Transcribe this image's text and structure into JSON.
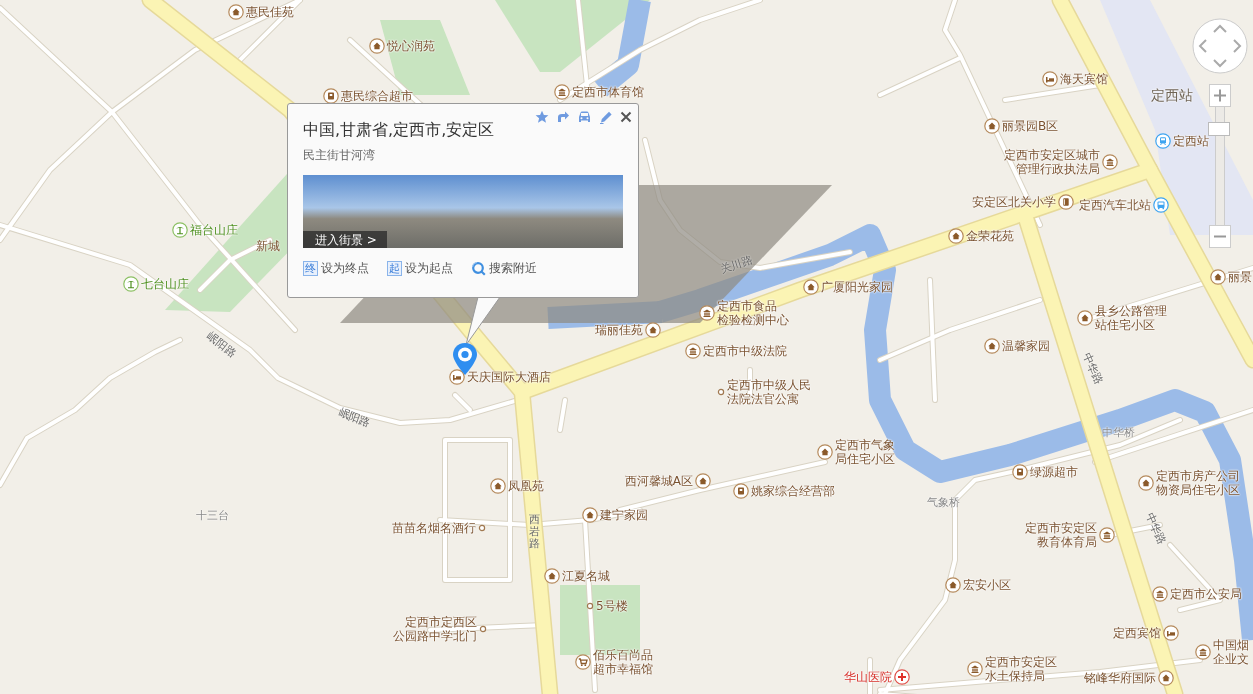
{
  "popup": {
    "title": "中国,甘肃省,定西市,安定区",
    "subtitle": "民主街甘河湾",
    "street_view_link": "进入街景 >",
    "actions": [
      {
        "kind": "badge",
        "badge": "终",
        "label": "设为终点"
      },
      {
        "kind": "badge",
        "badge": "起",
        "label": "设为起点"
      },
      {
        "kind": "search",
        "label": "搜索附近"
      }
    ]
  },
  "map": {
    "places": [
      {
        "kind": "house",
        "lines": [
          "惠民佳苑"
        ]
      },
      {
        "kind": "house",
        "lines": [
          "悦心润苑"
        ]
      },
      {
        "kind": "shop",
        "lines": [
          "惠民综合超市"
        ]
      },
      {
        "kind": "office",
        "lines": [
          "定西市体育馆"
        ]
      },
      {
        "kind": "hotel",
        "lines": [
          "海天宾馆"
        ]
      },
      {
        "kind": "house",
        "lines": [
          "丽景园B区"
        ]
      },
      {
        "kind": "metro",
        "lines": [
          "定西站"
        ]
      },
      {
        "kind": "office",
        "lines": [
          "定西市安定区城市",
          "管理行政执法局"
        ]
      },
      {
        "kind": "school",
        "lines": [
          "安定区北关小学"
        ]
      },
      {
        "kind": "bus",
        "lines": [
          "定西汽车北站"
        ]
      },
      {
        "kind": "house",
        "lines": [
          "金荣花苑"
        ]
      },
      {
        "kind": "house",
        "lines": [
          "丽景"
        ]
      },
      {
        "kind": "house",
        "lines": [
          "广厦阳光家园"
        ]
      },
      {
        "kind": "office",
        "lines": [
          "定西市食品",
          "检验检测中心"
        ]
      },
      {
        "kind": "house",
        "lines": [
          "瑞丽佳苑"
        ]
      },
      {
        "kind": "house",
        "lines": [
          "县乡公路管理",
          "站住宅小区"
        ]
      },
      {
        "kind": "house",
        "lines": [
          "温馨家园"
        ]
      },
      {
        "kind": "office",
        "lines": [
          "定西市中级法院"
        ]
      },
      {
        "kind": "hotel",
        "lines": [
          "天庆国际大酒店"
        ]
      },
      {
        "kind": "dot",
        "lines": [
          "定西市中级人民",
          "法院法官公寓"
        ]
      },
      {
        "kind": "house",
        "lines": [
          "定西市气象",
          "局住宅小区"
        ]
      },
      {
        "kind": "house",
        "lines": [
          "凤凰苑"
        ]
      },
      {
        "kind": "house",
        "lines": [
          "西河馨城A区"
        ]
      },
      {
        "kind": "shop",
        "lines": [
          "姚家综合经营部"
        ]
      },
      {
        "kind": "shop",
        "lines": [
          "绿源超市"
        ]
      },
      {
        "kind": "house",
        "lines": [
          "定西市房产公司",
          "物资局住宅小区"
        ]
      },
      {
        "kind": "house",
        "lines": [
          "建宁家园"
        ]
      },
      {
        "kind": "dot",
        "lines": [
          "苗苗名烟名酒行"
        ]
      },
      {
        "kind": "office",
        "lines": [
          "定西市安定区",
          "教育体育局"
        ]
      },
      {
        "kind": "house",
        "lines": [
          "江夏名城"
        ]
      },
      {
        "kind": "house",
        "lines": [
          "宏安小区"
        ]
      },
      {
        "kind": "office",
        "lines": [
          "定西市公安局"
        ]
      },
      {
        "kind": "dot",
        "lines": [
          "5号楼"
        ]
      },
      {
        "kind": "dot",
        "lines": [
          "定西市定西区",
          "公园路中学北门"
        ]
      },
      {
        "kind": "hotel",
        "lines": [
          "定西宾馆"
        ]
      },
      {
        "kind": "office",
        "lines": [
          "中国烟",
          "企业文"
        ]
      },
      {
        "kind": "cart",
        "lines": [
          "佰乐百尚品",
          "超市幸福馆"
        ]
      },
      {
        "kind": "hospital",
        "lines": [
          "华山医院"
        ]
      },
      {
        "kind": "office",
        "lines": [
          "定西市安定区",
          "水土保持局"
        ]
      },
      {
        "kind": "house",
        "lines": [
          "铭峰华府国际"
        ]
      },
      {
        "kind": "park",
        "lines": [
          "福台山庄"
        ]
      },
      {
        "kind": "park",
        "lines": [
          "七台山庄"
        ]
      }
    ],
    "area_labels": [
      {
        "kind": "station",
        "text": "定西站"
      },
      {
        "kind": "plain",
        "text": "十三台"
      },
      {
        "kind": "plain",
        "text": "中华桥"
      },
      {
        "kind": "plain",
        "text": "气象桥"
      },
      {
        "kind": "place",
        "text": "新城"
      }
    ],
    "road_labels": [
      {
        "text": "岷阳路"
      },
      {
        "text": "岷阳路"
      },
      {
        "text": "关川路"
      },
      {
        "text": "西岩路"
      },
      {
        "text": "中华路"
      },
      {
        "text": "中华路"
      }
    ]
  },
  "zoom": {
    "level": 0.86
  }
}
